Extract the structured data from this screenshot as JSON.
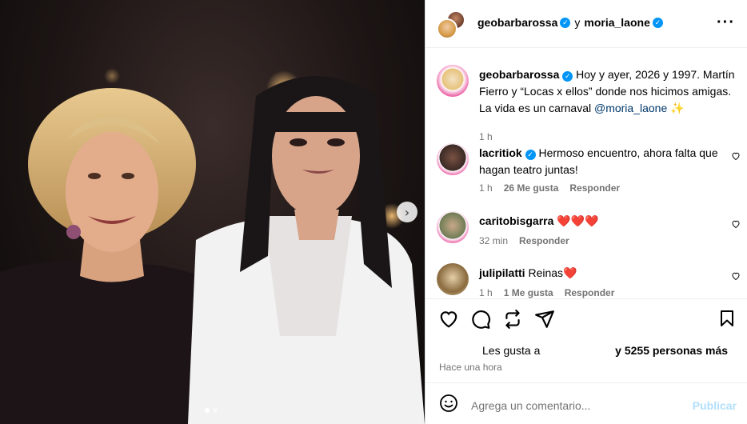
{
  "post": {
    "header": {
      "author": "geobarbarossa",
      "connector": "y",
      "coauthor": "moria_laone"
    },
    "caption": {
      "username": "geobarbarossa",
      "text": "Hoy y ayer, 2026 y 1997. Martín Fierro y “Locas x ellos” donde nos hicimos amigas. La vida es un carnaval",
      "mention": "@moria_laone",
      "emoji": "✨",
      "time": "1 h"
    },
    "comments": [
      {
        "username": "lacritiok",
        "verified": true,
        "text": "Hermoso encuentro, ahora falta que hagan teatro juntas!",
        "time": "1 h",
        "likes": "26 Me gusta",
        "reply": "Responder"
      },
      {
        "username": "caritobisgarra",
        "text": "❤️❤️❤️",
        "time": "32 min",
        "reply": "Responder"
      },
      {
        "username": "julipilatti",
        "text": "Reinas❤️",
        "time": "1 h",
        "likes": "1 Me gusta",
        "reply": "Responder"
      }
    ],
    "likes_prefix": "Les gusta a",
    "likes_suffix": "y 5255 personas más",
    "posted_time": "Hace una hora",
    "add_comment_placeholder": "Agrega un comentario...",
    "publish_label": "Publicar",
    "carousel": {
      "total": 2,
      "current": 1
    }
  },
  "icons": {
    "more": "more-options-icon",
    "like": "heart-icon",
    "comment": "comment-icon",
    "share": "repost-icon",
    "send": "send-icon",
    "save": "bookmark-icon",
    "emoji": "emoji-icon",
    "next": "chevron-right-icon"
  },
  "colors": {
    "verified": "#0095f6",
    "mention": "#00376b",
    "publish_disabled": "#b2dffc",
    "heart_red": "#ed4956"
  }
}
